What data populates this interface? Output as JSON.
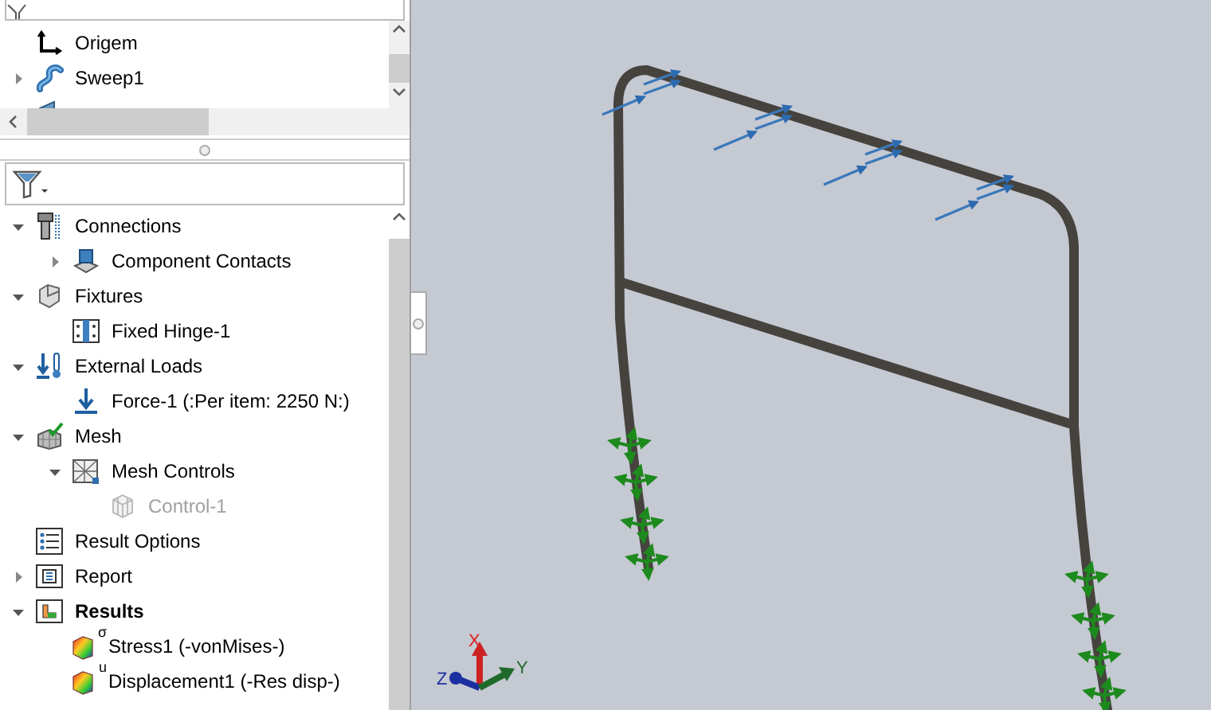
{
  "feature_tree": {
    "items": [
      {
        "label": "Origem",
        "kind": "origin"
      },
      {
        "label": "Sweep1",
        "kind": "sweep",
        "expanded": false
      },
      {
        "kind": "plane"
      }
    ]
  },
  "simulation_tree": {
    "items": [
      {
        "label": "Connections",
        "kind": "connections",
        "expanded": true,
        "children": [
          {
            "label": "Component Contacts",
            "kind": "contacts",
            "expanded": false
          }
        ]
      },
      {
        "label": "Fixtures",
        "kind": "fixtures",
        "expanded": true,
        "children": [
          {
            "label": "Fixed Hinge-1",
            "kind": "hinge"
          }
        ]
      },
      {
        "label": "External Loads",
        "kind": "loads",
        "expanded": true,
        "children": [
          {
            "label": "Force-1 (:Per item: 2250 N:)",
            "kind": "force"
          }
        ]
      },
      {
        "label": "Mesh",
        "kind": "mesh",
        "expanded": true,
        "children": [
          {
            "label": "Mesh Controls",
            "kind": "mesh_controls",
            "expanded": true,
            "children": [
              {
                "label": "Control-1",
                "kind": "control",
                "disabled": true
              }
            ]
          }
        ]
      },
      {
        "label": "Result Options",
        "kind": "options"
      },
      {
        "label": "Report",
        "kind": "report",
        "expanded": false
      },
      {
        "label": "Results",
        "kind": "results",
        "expanded": true,
        "bold": true,
        "children": [
          {
            "label": "Stress1 (-vonMises-)",
            "kind": "plot",
            "symbol": "σ"
          },
          {
            "label": "Displacement1 (-Res disp-)",
            "kind": "plot",
            "symbol": "u"
          }
        ]
      }
    ]
  },
  "triad": {
    "x": "X",
    "y": "Y",
    "z": "Z"
  }
}
